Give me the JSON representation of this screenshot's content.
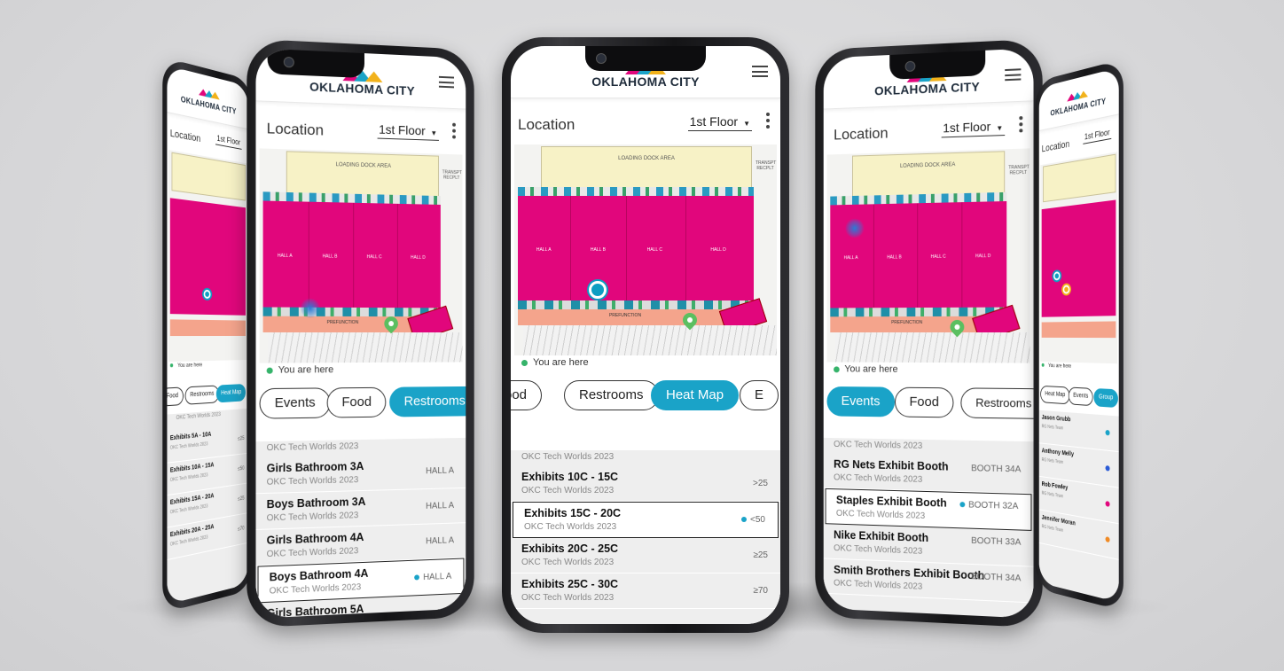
{
  "app": {
    "brand": "OKLAHOMA CITY",
    "location_title": "Location",
    "floor": "1st Floor",
    "you_are_here": "You are here",
    "dock_label": "LOADING DOCK AREA",
    "trans_label": "TRANSPT RECPLT",
    "prefunction_label": "PREFUNCTION",
    "halls": [
      "HALL A",
      "HALL B",
      "HALL C",
      "HALL D"
    ]
  },
  "colors": {
    "accent": "#1aa3c8",
    "hall": "#e1067c",
    "you_are_here": "#35b36a",
    "prefunction": "#f4a48c"
  },
  "phone_far_left": {
    "chips": [
      "Food",
      "Restrooms",
      "Heat Map"
    ],
    "chips_active": 2,
    "list_partial": "OKC Tech Worlds 2023",
    "list": [
      {
        "title": "Exhibits 5A - 10A",
        "sub": "OKC Tech Worlds 2023",
        "right": "≤25"
      },
      {
        "title": "Exhibits 10A - 15A",
        "sub": "OKC Tech Worlds 2023",
        "right": "≤50"
      },
      {
        "title": "Exhibits 15A - 20A",
        "sub": "OKC Tech Worlds 2023",
        "right": "≤25"
      },
      {
        "title": "Exhibits 20A - 25A",
        "sub": "OKC Tech Worlds 2023",
        "right": "≤70"
      }
    ]
  },
  "phone_left": {
    "chips": [
      "Events",
      "Food",
      "Restrooms"
    ],
    "chips_active": 2,
    "list_partial": "OKC Tech Worlds 2023",
    "list": [
      {
        "title": "Girls Bathroom 3A",
        "sub": "OKC Tech Worlds 2023",
        "right": "HALL A",
        "selected": false
      },
      {
        "title": "Boys Bathroom 3A",
        "sub": "OKC Tech Worlds 2023",
        "right": "HALL A",
        "selected": false
      },
      {
        "title": "Girls Bathroom 4A",
        "sub": "OKC Tech Worlds 2023",
        "right": "HALL A",
        "selected": false
      },
      {
        "title": "Boys Bathroom 4A",
        "sub": "OKC Tech Worlds 2023",
        "right": "HALL A",
        "selected": true
      },
      {
        "title": "Girls Bathroom 5A",
        "sub": "",
        "right": "",
        "selected": false
      }
    ]
  },
  "phone_center": {
    "chips": [
      "ood",
      "Restrooms",
      "Heat Map",
      "E"
    ],
    "chips_active": 2,
    "list_partial": "OKC Tech Worlds 2023",
    "list": [
      {
        "title": "Exhibits 10C - 15C",
        "sub": "OKC Tech Worlds 2023",
        "right": ">25",
        "selected": false
      },
      {
        "title": "Exhibits 15C - 20C",
        "sub": "OKC Tech Worlds 2023",
        "right": "<50",
        "selected": true
      },
      {
        "title": "Exhibits 20C - 25C",
        "sub": "OKC Tech Worlds 2023",
        "right": "≥25",
        "selected": false
      },
      {
        "title": "Exhibits 25C - 30C",
        "sub": "OKC Tech Worlds 2023",
        "right": "≥70",
        "selected": false
      }
    ]
  },
  "phone_right": {
    "chips": [
      "Events",
      "Food",
      "Restrooms"
    ],
    "chips_active": 0,
    "list_partial": "OKC Tech Worlds 2023",
    "list": [
      {
        "title": "RG Nets Exhibit Booth",
        "sub": "OKC Tech Worlds 2023",
        "right": "BOOTH 34A",
        "selected": false
      },
      {
        "title": "Staples Exhibit Booth",
        "sub": "OKC Tech Worlds 2023",
        "right": "BOOTH 32A",
        "selected": true
      },
      {
        "title": "Nike Exhibit Booth",
        "sub": "OKC Tech Worlds 2023",
        "right": "BOOTH 33A",
        "selected": false
      },
      {
        "title": "Smith Brothers Exhibit Booth",
        "sub": "OKC Tech Worlds 2023",
        "right": "BOOTH 34A",
        "selected": false
      }
    ]
  },
  "phone_far_right": {
    "chips": [
      "Heat Map",
      "Events",
      "Group"
    ],
    "chips_active": 2,
    "list": [
      {
        "title": "Jason Grubb",
        "sub": "RG Nets Team"
      },
      {
        "title": "Anthony Melly",
        "sub": "RG Nets Team"
      },
      {
        "title": "Rob Fowley",
        "sub": "RG Nets Team"
      },
      {
        "title": "Jennifer Moran",
        "sub": "RG Nets Team"
      }
    ]
  }
}
